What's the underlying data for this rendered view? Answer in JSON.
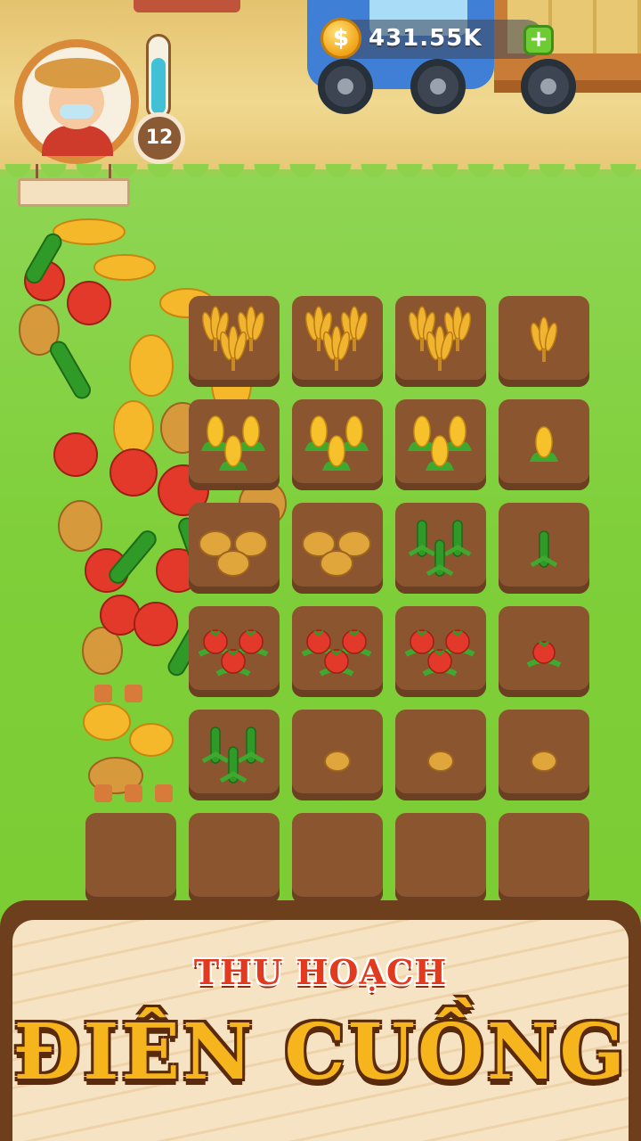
{
  "hud": {
    "coins": "431.55K",
    "coin_icon": "$",
    "add_icon": "+",
    "level": "12",
    "energy_fraction": 0.75
  },
  "banner": {
    "line1": "THU HOẠCH",
    "line2": "ĐIÊN CUỒNG"
  },
  "grid": {
    "rows": [
      [
        "wheat-full",
        "wheat-full",
        "wheat-full",
        "wheat-small"
      ],
      [
        "corn-full",
        "corn-full",
        "corn-full",
        "corn-small"
      ],
      [
        "potato-full",
        "potato-full",
        "cucumber-full",
        "cucumber-small"
      ],
      [
        "tomato-full",
        "tomato-full",
        "tomato-full",
        "tomato-small"
      ],
      [
        "cucumber-full",
        "potato-small",
        "potato-small",
        "potato-small"
      ],
      [
        "empty",
        "empty",
        "empty",
        "empty",
        "empty"
      ]
    ]
  },
  "colors": {
    "grass": "#7fcf3a",
    "soil": "#8b5530",
    "accent_gold": "#f6b51d",
    "accent_red": "#e23a1f"
  }
}
